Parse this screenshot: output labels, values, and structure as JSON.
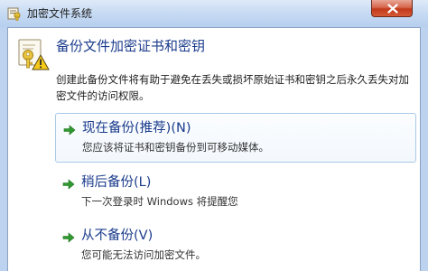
{
  "window": {
    "title": "加密文件系统"
  },
  "heading": "备份文件加密证书和密钥",
  "description": "创建此备份文件将有助于避免在丢失或损坏原始证书和密钥之后永久丢失对加密文件的访问权限。",
  "options": [
    {
      "title": "现在备份(推荐)(N)",
      "subtitle": "您应该将证书和密钥备份到可移动媒体。",
      "selected": true
    },
    {
      "title": "稍后备份(L)",
      "subtitle": "下一次登录时 Windows 将提醒您",
      "selected": false
    },
    {
      "title": "从不备份(V)",
      "subtitle": "您可能无法访问加密文件。",
      "selected": false
    }
  ],
  "icons": {
    "title": "certificate-key-icon",
    "header": "key-warning-icon",
    "option": "green-arrow-icon",
    "close": "close-icon"
  },
  "colors": {
    "heading": "#1b3c8c",
    "arrow": "#2f9a2f",
    "close_button": "#c2391b",
    "selected_border": "#a9c9e6"
  }
}
